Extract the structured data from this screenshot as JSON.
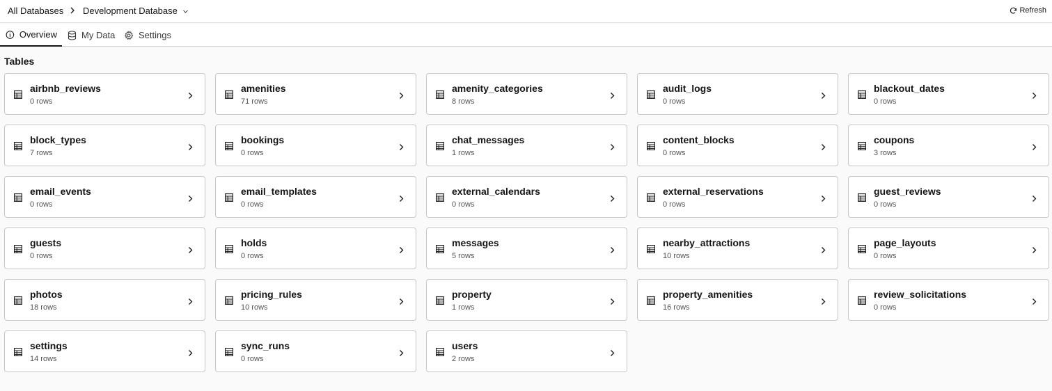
{
  "breadcrumb": {
    "root": "All Databases",
    "current": "Development Database"
  },
  "header": {
    "refresh_label": "Refresh"
  },
  "tabs": [
    {
      "label": "Overview",
      "icon": "info-icon",
      "active": true
    },
    {
      "label": "My Data",
      "icon": "database-icon",
      "active": false
    },
    {
      "label": "Settings",
      "icon": "gear-icon",
      "active": false
    }
  ],
  "section_title": "Tables",
  "tables": [
    {
      "name": "airbnb_reviews",
      "rows": "0 rows"
    },
    {
      "name": "amenities",
      "rows": "71 rows"
    },
    {
      "name": "amenity_categories",
      "rows": "8 rows"
    },
    {
      "name": "audit_logs",
      "rows": "0 rows"
    },
    {
      "name": "blackout_dates",
      "rows": "0 rows"
    },
    {
      "name": "block_types",
      "rows": "7 rows"
    },
    {
      "name": "bookings",
      "rows": "0 rows"
    },
    {
      "name": "chat_messages",
      "rows": "1 rows"
    },
    {
      "name": "content_blocks",
      "rows": "0 rows"
    },
    {
      "name": "coupons",
      "rows": "3 rows"
    },
    {
      "name": "email_events",
      "rows": "0 rows"
    },
    {
      "name": "email_templates",
      "rows": "0 rows"
    },
    {
      "name": "external_calendars",
      "rows": "0 rows"
    },
    {
      "name": "external_reservations",
      "rows": "0 rows"
    },
    {
      "name": "guest_reviews",
      "rows": "0 rows"
    },
    {
      "name": "guests",
      "rows": "0 rows"
    },
    {
      "name": "holds",
      "rows": "0 rows"
    },
    {
      "name": "messages",
      "rows": "5 rows"
    },
    {
      "name": "nearby_attractions",
      "rows": "10 rows"
    },
    {
      "name": "page_layouts",
      "rows": "0 rows"
    },
    {
      "name": "photos",
      "rows": "18 rows"
    },
    {
      "name": "pricing_rules",
      "rows": "10 rows"
    },
    {
      "name": "property",
      "rows": "1 rows"
    },
    {
      "name": "property_amenities",
      "rows": "16 rows"
    },
    {
      "name": "review_solicitations",
      "rows": "0 rows"
    },
    {
      "name": "settings",
      "rows": "14 rows"
    },
    {
      "name": "sync_runs",
      "rows": "0 rows"
    },
    {
      "name": "users",
      "rows": "2 rows"
    }
  ]
}
